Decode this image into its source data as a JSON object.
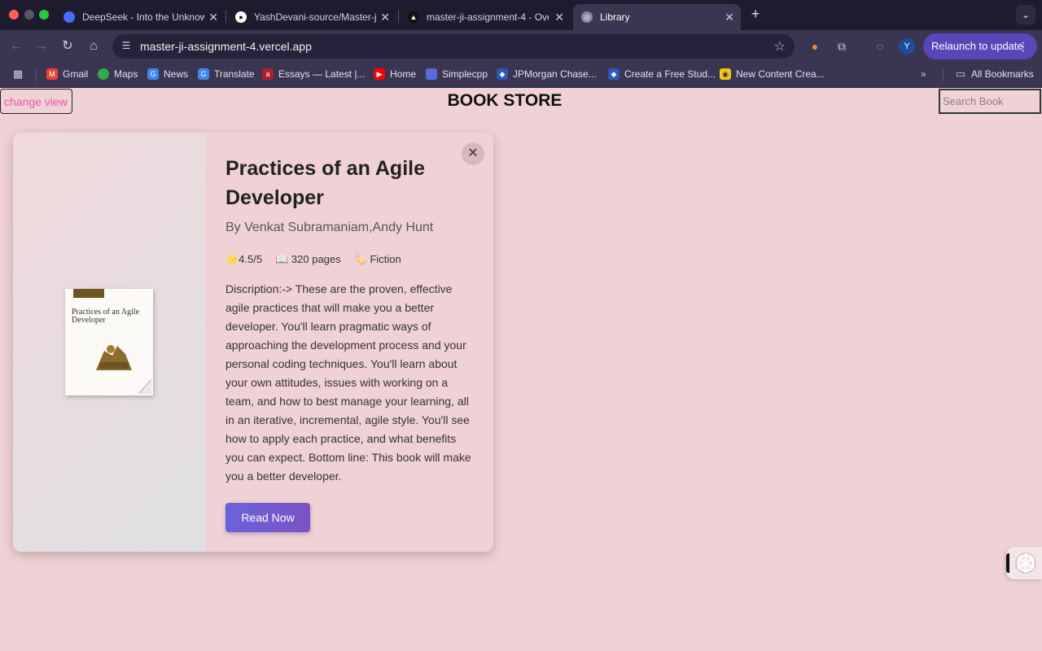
{
  "browser": {
    "tabs": [
      {
        "title": "DeepSeek - Into the Unknown",
        "favicon": "deepseek-icon",
        "active": false
      },
      {
        "title": "YashDevani-source/Master-ji",
        "favicon": "github-icon",
        "active": false
      },
      {
        "title": "master-ji-assignment-4 - Ove",
        "favicon": "vercel-icon",
        "active": false
      },
      {
        "title": "Library",
        "favicon": "globe-icon",
        "active": true
      }
    ],
    "url": "master-ji-assignment-4.vercel.app",
    "profile_initial": "Y",
    "relaunch_label": "Relaunch to update",
    "bookmarks": [
      {
        "label": "Gmail",
        "icon": "gmail-icon"
      },
      {
        "label": "Maps",
        "icon": "maps-icon"
      },
      {
        "label": "News",
        "icon": "news-icon"
      },
      {
        "label": "Translate",
        "icon": "translate-icon"
      },
      {
        "label": "Essays — Latest |...",
        "icon": "essays-icon"
      },
      {
        "label": "Home",
        "icon": "youtube-icon"
      },
      {
        "label": "Simplecpp",
        "icon": "simplecpp-icon"
      },
      {
        "label": "JPMorgan Chase...",
        "icon": "jpmorgan-icon"
      },
      {
        "label": "Create a Free Stud...",
        "icon": "create-icon"
      },
      {
        "label": "New Content Crea...",
        "icon": "content-icon"
      }
    ],
    "all_bookmarks_label": "All Bookmarks"
  },
  "header": {
    "change_view_label": "change view",
    "title": "BOOK STORE",
    "search_placeholder": "Search Book"
  },
  "book": {
    "title": "Practices of an Agile Developer",
    "author": "By Venkat Subramaniam,Andy Hunt",
    "rating": "⭐4.5/5",
    "pages": "📖 320 pages",
    "genre": "🏷️ Fiction",
    "description": "Discription:-> These are the proven, effective agile practices that will make you a better developer. You'll learn pragmatic ways of approaching the development process and your personal coding techniques. You'll learn about your own attitudes, issues with working on a team, and how to best manage your learning, all in an iterative, incremental, agile style. You'll see how to apply each practice, and what benefits you can expect. Bottom line: This book will make you a better developer.",
    "cover_title": "Practices of an Agile Developer",
    "read_button_label": "Read Now"
  },
  "colors": {
    "page_background": "#f0d2d6",
    "accent": "#6a63d8",
    "link_pink": "#e75aa6"
  }
}
